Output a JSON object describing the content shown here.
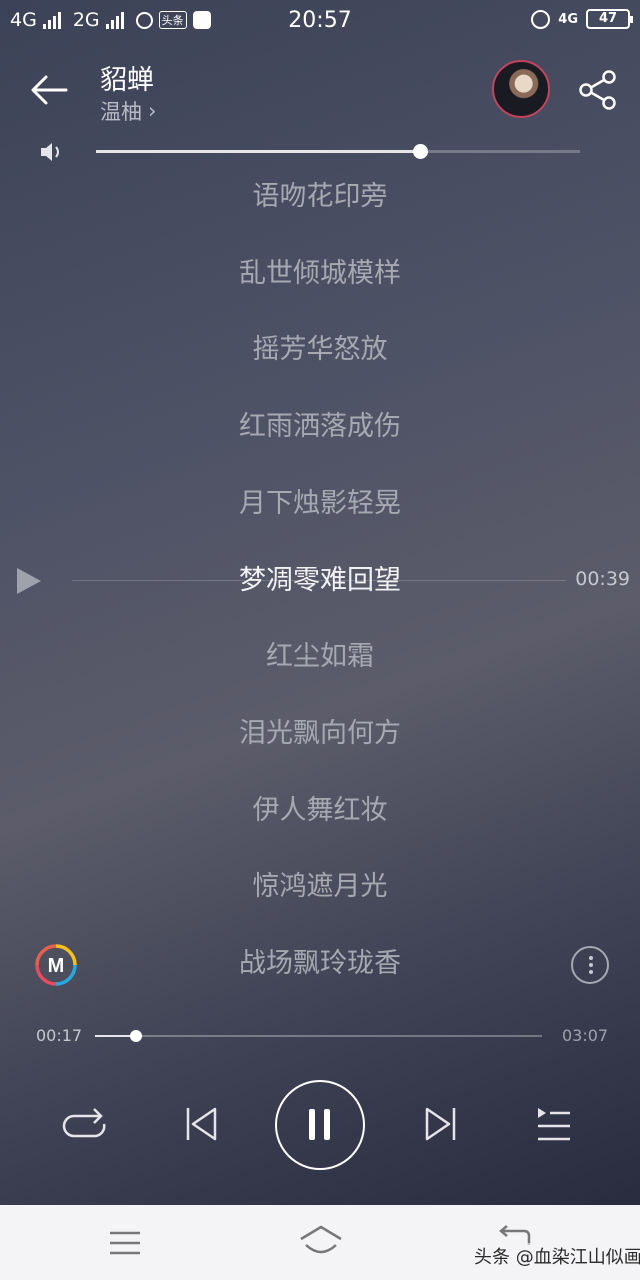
{
  "status_bar": {
    "network_1": "4G",
    "network_2": "2G",
    "news_badge": "头条",
    "time": "20:57",
    "network_right": "4G",
    "battery": "47"
  },
  "header": {
    "title": "貂蝉",
    "artist": "温柚",
    "artist_chevron": "›"
  },
  "volume": {
    "level": 0.67
  },
  "lyrics": [
    {
      "text": "语吻花印旁",
      "active": false
    },
    {
      "text": "乱世倾城模样",
      "active": false
    },
    {
      "text": "摇芳华怒放",
      "active": false
    },
    {
      "text": "红雨洒落成伤",
      "active": false
    },
    {
      "text": "月下烛影轻晃",
      "active": false
    },
    {
      "text": "梦凋零难回望",
      "active": true
    },
    {
      "text": "红尘如霜",
      "active": false
    },
    {
      "text": "泪光飘向何方",
      "active": false
    },
    {
      "text": "伊人舞红妆",
      "active": false
    },
    {
      "text": "惊鸿遮月光",
      "active": false
    },
    {
      "text": "战场飘玲珑香",
      "active": false
    }
  ],
  "seek_time": "00:39",
  "progress": {
    "current": "00:17",
    "total": "03:07",
    "fraction": 0.092
  },
  "logo_letter": "M",
  "watermark": "头条 @血染江山似画",
  "icons": {
    "back": "arrow-left-icon",
    "share": "share-icon",
    "volume": "speaker-icon",
    "seek_play": "play-icon",
    "logo": "app-logo-icon",
    "more": "more-vertical-icon",
    "repeat": "repeat-icon",
    "prev": "previous-icon",
    "pause": "pause-icon",
    "next": "next-icon",
    "playlist": "playlist-icon"
  },
  "colors": {
    "accent_ring": "#c2445e",
    "active_lyric": "#f2f2f5",
    "inactive_lyric": "#a6a8b2"
  }
}
